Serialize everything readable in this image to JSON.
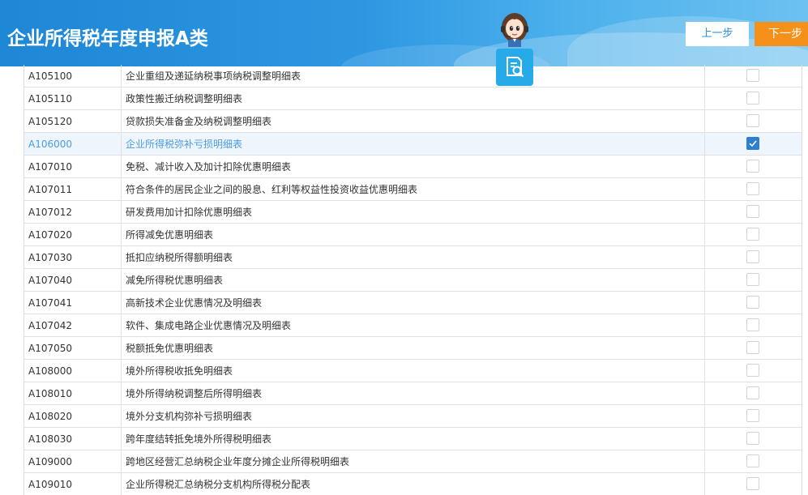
{
  "header": {
    "title": "企业所得税年度申报A类",
    "prev_label": "上一步",
    "next_label": "下一步",
    "avatar_icon": "customer-service-avatar-icon",
    "search_icon": "document-search-icon"
  },
  "colors": {
    "header_blue": "#1e87d6",
    "next_orange": "#f5901a",
    "checkbox_blue": "#2f7fd0",
    "selected_text": "#4a9be0"
  },
  "rows": [
    {
      "code": "A105100",
      "name": "企业重组及递延纳税事项纳税调整明细表",
      "checked": false
    },
    {
      "code": "A105110",
      "name": "政策性搬迁纳税调整明细表",
      "checked": false
    },
    {
      "code": "A105120",
      "name": "贷款损失准备金及纳税调整明细表",
      "checked": false
    },
    {
      "code": "A106000",
      "name": "企业所得税弥补亏损明细表",
      "checked": true
    },
    {
      "code": "A107010",
      "name": "免税、减计收入及加计扣除优惠明细表",
      "checked": false
    },
    {
      "code": "A107011",
      "name": "符合条件的居民企业之间的股息、红利等权益性投资收益优惠明细表",
      "checked": false
    },
    {
      "code": "A107012",
      "name": "研发费用加计扣除优惠明细表",
      "checked": false
    },
    {
      "code": "A107020",
      "name": "所得减免优惠明细表",
      "checked": false
    },
    {
      "code": "A107030",
      "name": "抵扣应纳税所得额明细表",
      "checked": false
    },
    {
      "code": "A107040",
      "name": "减免所得税优惠明细表",
      "checked": false
    },
    {
      "code": "A107041",
      "name": "高新技术企业优惠情况及明细表",
      "checked": false
    },
    {
      "code": "A107042",
      "name": "软件、集成电路企业优惠情况及明细表",
      "checked": false
    },
    {
      "code": "A107050",
      "name": "税额抵免优惠明细表",
      "checked": false
    },
    {
      "code": "A108000",
      "name": "境外所得税收抵免明细表",
      "checked": false
    },
    {
      "code": "A108010",
      "name": "境外所得纳税调整后所得明细表",
      "checked": false
    },
    {
      "code": "A108020",
      "name": "境外分支机构弥补亏损明细表",
      "checked": false
    },
    {
      "code": "A108030",
      "name": "跨年度结转抵免境外所得税明细表",
      "checked": false
    },
    {
      "code": "A109000",
      "name": "跨地区经营汇总纳税企业年度分摊企业所得税明细表",
      "checked": false
    },
    {
      "code": "A109010",
      "name": "企业所得税汇总纳税分支机构所得税分配表",
      "checked": false
    }
  ]
}
